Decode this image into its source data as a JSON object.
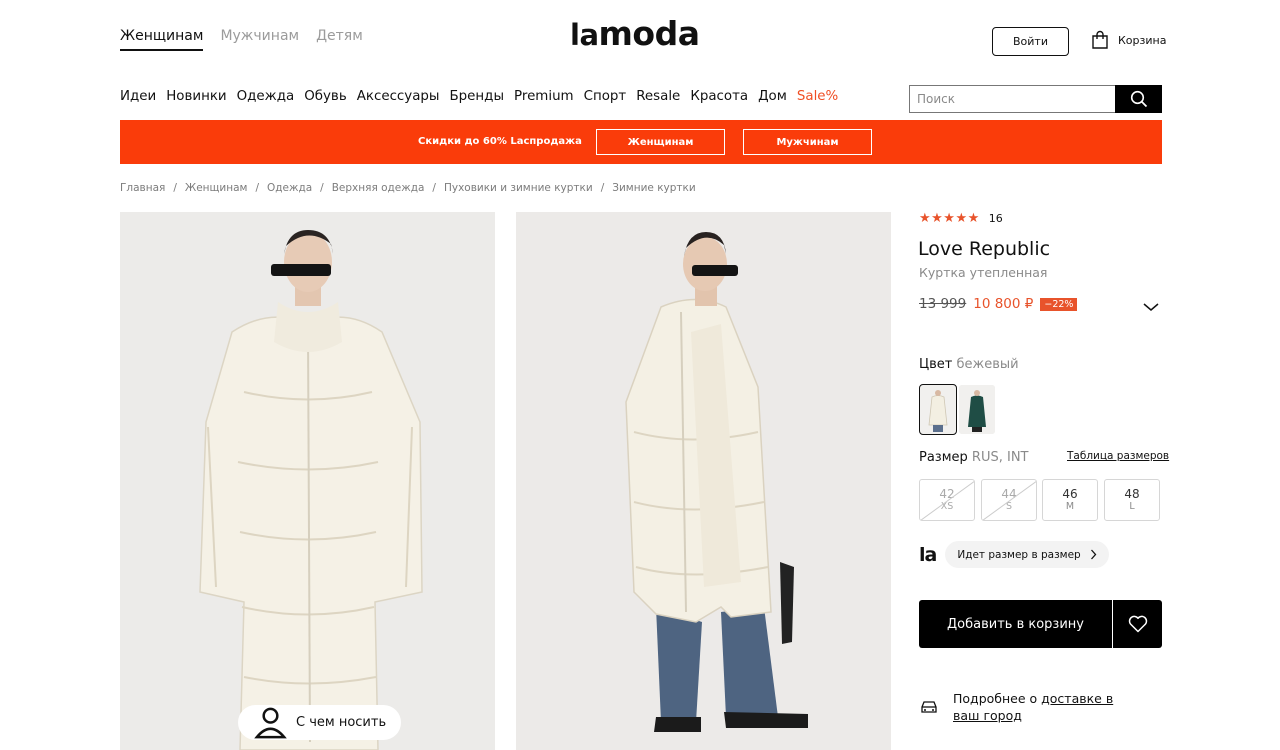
{
  "header": {
    "gender_tabs": [
      {
        "label": "Женщинам",
        "active": true
      },
      {
        "label": "Мужчинам",
        "active": false
      },
      {
        "label": "Детям",
        "active": false
      }
    ],
    "logo_prefix": "la",
    "logo_suffix": "moda",
    "login_label": "Войти",
    "cart_label": "Корзина"
  },
  "nav": {
    "items": [
      "Идеи",
      "Новинки",
      "Одежда",
      "Обувь",
      "Аксессуары",
      "Бренды",
      "Premium",
      "Спорт",
      "Resale",
      "Красота",
      "Дом",
      "Sale%"
    ],
    "search_placeholder": "Поиск",
    "sale_color": "#f04e23"
  },
  "promo": {
    "text": "Скидки до 60% Lаспродажа",
    "buttons": [
      "Женщинам",
      "Мужчинам"
    ],
    "background": "#fa3c0a"
  },
  "breadcrumbs": [
    "Главная",
    "Женщинам",
    "Одежда",
    "Верхняя одежда",
    "Пуховики и зимние куртки",
    "Зимние куртки"
  ],
  "gallery": {
    "how_to_wear_label": "С чем носить"
  },
  "product": {
    "rating_stars": "★★★★★",
    "rating_value": 5,
    "review_count": "16",
    "brand": "Love Republic",
    "type": "Куртка утепленная",
    "old_price": "13 999",
    "new_price": "10 800 ₽",
    "discount": "−22%",
    "accent_color": "#e8532b",
    "color_label": "Цвет",
    "color_value": "бежевый",
    "colors": [
      {
        "name": "бежевый",
        "selected": true
      },
      {
        "name": "зеленый",
        "selected": false
      }
    ],
    "size_label": "Размер",
    "size_systems": "RUS, INT",
    "size_table_label": "Таблица размеров",
    "sizes": [
      {
        "rus": "42",
        "int": "XS",
        "available": false
      },
      {
        "rus": "44",
        "int": "S",
        "available": false
      },
      {
        "rus": "46",
        "int": "M",
        "available": true
      },
      {
        "rus": "48",
        "int": "L",
        "available": true
      }
    ],
    "fit_logo": "la",
    "fit_label": "Идет размер в размер",
    "add_to_cart_label": "Добавить в корзину",
    "delivery_text_1": "Подробнее о ",
    "delivery_text_2": "доставке в ваш город"
  }
}
